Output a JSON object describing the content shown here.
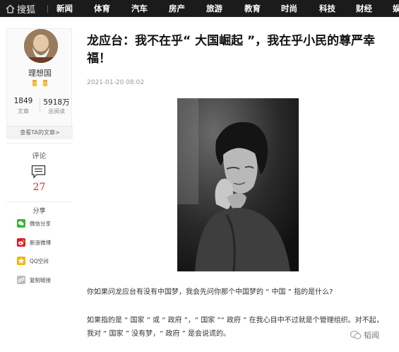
{
  "nav": {
    "logo": "搜狐",
    "items": [
      "新闻",
      "体育",
      "汽车",
      "房产",
      "旅游",
      "教育",
      "时尚",
      "科技",
      "财经",
      "娱"
    ]
  },
  "author": {
    "name": "理想国",
    "articles_count": "1849",
    "articles_label": "文章",
    "views_count": "5918万",
    "views_label": "总阅读",
    "view_link": "查看TA的文章>"
  },
  "comment": {
    "label": "评论",
    "count": "27"
  },
  "share": {
    "label": "分享",
    "items": [
      {
        "label": "微信分享",
        "icon": "wechat-icon",
        "color": "#3cb034"
      },
      {
        "label": "新浪微博",
        "icon": "weibo-icon",
        "color": "#e6162d"
      },
      {
        "label": "QQ空间",
        "icon": "qzone-icon",
        "color": "#f5b400"
      },
      {
        "label": "复制链接",
        "icon": "link-icon",
        "color": "#bdbdbd"
      }
    ]
  },
  "article": {
    "title": "龙应台：我不在乎“ 大国崛起 ”，我在乎小民的尊严幸福！",
    "date": "2021-01-20 08:02",
    "paragraphs": [
      "你如果问龙应台有没有中国梦，我会先问你那个中国梦的 “ 中国 ” 指的是什么?",
      "如果指的是 “ 国家 ” 或 “ 政府 ”，“ 国家 ”“ 政府 ” 在我心目中不过就是个管理组织。对不起，",
      "我对 “ 国家 ” 没有梦，“ 政府 ” 是会说谎的。"
    ]
  },
  "watermark": "韬闻"
}
